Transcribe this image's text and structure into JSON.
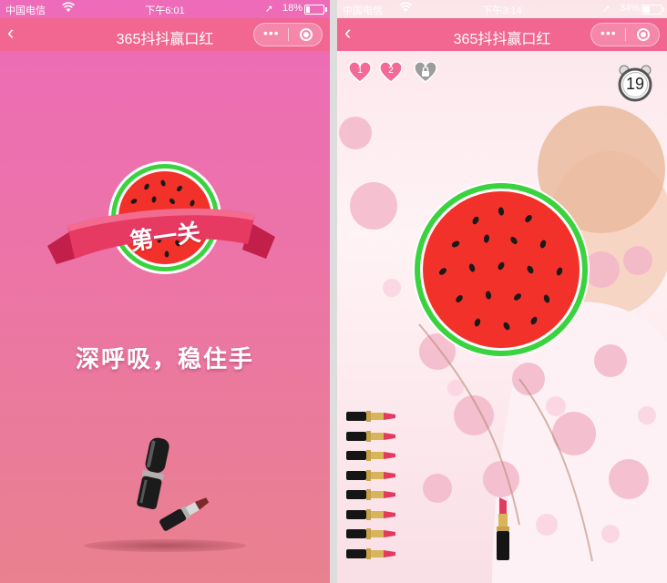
{
  "left": {
    "status": {
      "carrier": "中国电信",
      "time": "下午6:01",
      "battery": "18%",
      "battery_level": 0.18
    },
    "nav": {
      "back_icon": "chevron-left-icon",
      "title": "365抖抖赢口红",
      "more_icon": "more-dots-icon",
      "close_icon": "close-target-icon"
    },
    "level_label": "第一关",
    "hint": "深呼吸，稳住手"
  },
  "right": {
    "status": {
      "carrier": "中国电信",
      "time": "下午3:14",
      "battery": "34%",
      "battery_level": 0.34
    },
    "nav": {
      "back_icon": "chevron-left-icon",
      "title": "365抖抖赢口红",
      "more_icon": "more-dots-icon",
      "close_icon": "close-target-icon"
    },
    "stages": [
      {
        "label": "1",
        "state": "done"
      },
      {
        "label": "2",
        "state": "done"
      },
      {
        "label": "",
        "state": "locked"
      }
    ],
    "timer": "19",
    "lipsticks_remaining": 8
  },
  "colors": {
    "nav": "#f26692",
    "melon_red": "#f2322a",
    "rind": "#3bd23f",
    "heart": "#f36a99"
  }
}
